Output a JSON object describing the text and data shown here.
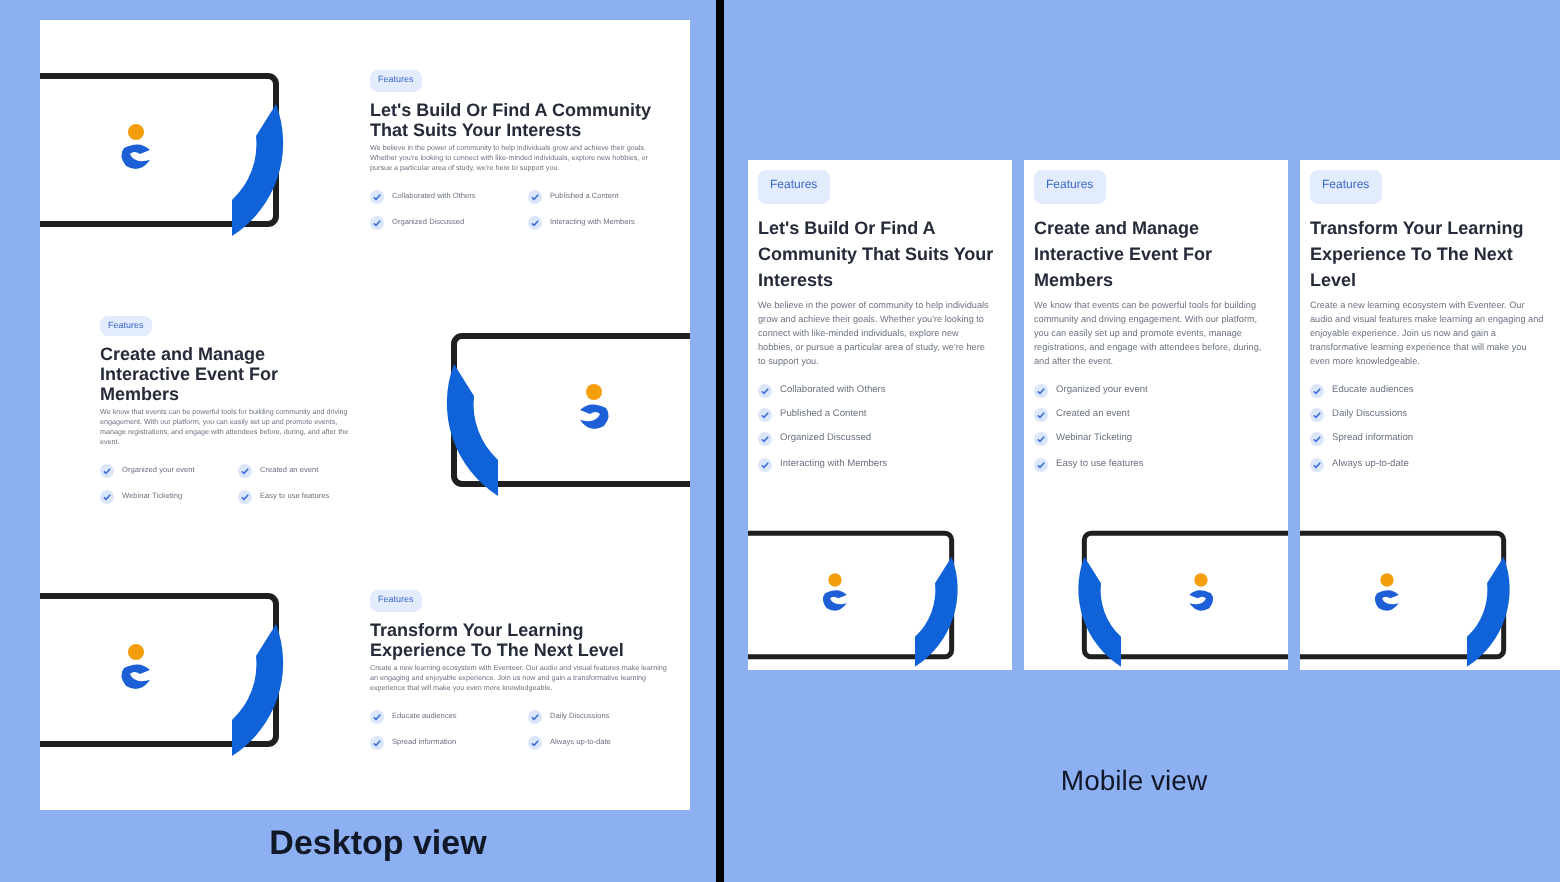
{
  "desktop_view": {
    "sections": [
      {
        "kind": "image_left",
        "badge": "Features",
        "title": "Let's Build Or Find A Community That Suits Your Interests",
        "paragraph": "We believe in the power of community to help individuals grow and achieve their goals. Whether you're looking to connect with like-minded individuals, explore new hobbies, or pursue a particular area of study, we're here to support you.",
        "features": [
          "Collaborated with Others",
          "Published a Content",
          "Organized Discussed",
          "Interacting with Members"
        ]
      },
      {
        "kind": "image_right",
        "badge": "Features",
        "title": "Create and Manage Interactive Event For Members",
        "paragraph": "We know that events can be powerful tools for building community and driving engagement. With our platform, you can easily set up and promote events, manage registrations, and engage with attendees before, during, and after the event.",
        "features": [
          "Organized your event",
          "Created an event",
          "Webinar Ticketing",
          "Easy to use features"
        ]
      },
      {
        "kind": "image_left",
        "badge": "Features",
        "title": "Transform Your Learning Experience To The Next Level",
        "paragraph": "Create a new learning ecosystem with Eventeer. Our audio and visual features make learning an engaging and enjoyable experience. Join us now and gain a transformative learning experience that will make you even more knowledgeable.",
        "features": [
          "Educate audiences",
          "Daily Discussions",
          "Spread information",
          "Always up-to-date"
        ]
      }
    ]
  },
  "desktop_caption": "Desktop view",
  "mobile_view": {
    "cards": [
      {
        "badge": "Features",
        "title": "Let's Build Or Find A Community That Suits Your Interests",
        "paragraph": "We believe in the power of community to help individuals grow and achieve their goals. Whether you're looking to connect with like-minded individuals, explore new hobbies, or pursue a particular area of study, we're here to support you.",
        "features": [
          "Collaborated with Others",
          "Published a Content",
          "Organized Discussed",
          "Interacting with Members"
        ],
        "kind": "image_left"
      },
      {
        "badge": "Features",
        "title": "Create and Manage Interactive Event For Members",
        "paragraph": "We know that events can be powerful tools for building community and driving engagement. With our platform, you can easily set up and promote events, manage registrations, and engage with attendees before, during, and after the event.",
        "features": [
          "Organized your event",
          "Created an event",
          "Webinar Ticketing",
          "Easy to use features"
        ],
        "kind": "image_right"
      },
      {
        "badge": "Features",
        "title": "Transform Your Learning Experience To The Next Level",
        "paragraph": "Create a new learning ecosystem with Eventeer. Our audio and visual features make learning an engaging and enjoyable experience. Join us now and gain a transformative learning experience that will make you even more knowledgeable.",
        "features": [
          "Educate audiences",
          "Daily Discussions",
          "Spread information",
          "Always up-to-date"
        ],
        "kind": "image_left"
      }
    ]
  },
  "mobile_caption": "Mobile view"
}
